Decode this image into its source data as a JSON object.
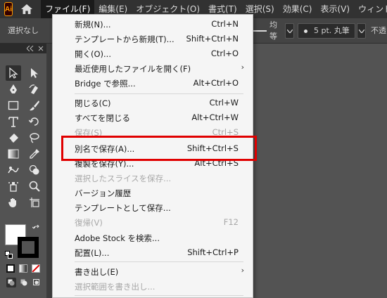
{
  "app": {
    "logo_text": "Ai",
    "accent": "#ff9a00"
  },
  "menubar": {
    "items": [
      {
        "label": "ファイル(F)",
        "active": true
      },
      {
        "label": "編集(E)"
      },
      {
        "label": "オブジェクト(O)"
      },
      {
        "label": "書式(T)"
      },
      {
        "label": "選択(S)"
      },
      {
        "label": "効果(C)"
      },
      {
        "label": "表示(V)"
      },
      {
        "label": "ウィンド"
      }
    ]
  },
  "controlbar": {
    "selection": "選択なし",
    "align": "均等",
    "stroke": "5 pt. 丸筆",
    "opacity": "不透"
  },
  "file_menu": {
    "items": [
      {
        "label": "新規(N)...",
        "shortcut": "Ctrl+N"
      },
      {
        "label": "テンプレートから新規(T)...",
        "shortcut": "Shift+Ctrl+N"
      },
      {
        "label": "開く(O)...",
        "shortcut": "Ctrl+O"
      },
      {
        "label": "最近使用したファイルを開く(F)",
        "submenu": true
      },
      {
        "label": "Bridge で参照...",
        "shortcut": "Alt+Ctrl+O"
      },
      {
        "label": "閉じる(C)",
        "shortcut": "Ctrl+W"
      },
      {
        "label": "すべてを閉じる",
        "shortcut": "Alt+Ctrl+W"
      },
      {
        "label": "保存(S)",
        "shortcut": "Ctrl+S",
        "disabled": true
      },
      {
        "label": "別名で保存(A)...",
        "shortcut": "Shift+Ctrl+S"
      },
      {
        "label": "複製を保存(Y)...",
        "shortcut": "Alt+Ctrl+S"
      },
      {
        "label": "選択したスライスを保存...",
        "disabled": true
      },
      {
        "label": "バージョン履歴"
      },
      {
        "label": "テンプレートとして保存..."
      },
      {
        "label": "復帰(V)",
        "shortcut": "F12",
        "disabled": true
      },
      {
        "label": "Adobe Stock を検索..."
      },
      {
        "label": "配置(L)...",
        "shortcut": "Shift+Ctrl+P"
      },
      {
        "label": "書き出し(E)",
        "submenu": true
      },
      {
        "label": "選択範囲を書き出し...",
        "disabled": true
      }
    ],
    "submenu_arrow": "›",
    "highlight_color": "#e00000"
  },
  "toolbar": {
    "tools": [
      "selection-tool",
      "direct-selection-tool",
      "pen-tool",
      "curvature-tool",
      "rectangle-tool",
      "paintbrush-tool",
      "type-tool",
      "rotate-tool",
      "eraser-tool",
      "lasso-tool",
      "gradient-tool",
      "eyedropper-tool",
      "puppet-warp-tool",
      "shape-builder-tool",
      "symbol-sprayer-tool",
      "zoom-tool",
      "hand-tool",
      "artboard-tool"
    ],
    "fill_color": "#ffffff",
    "stroke_color": "#000000"
  }
}
